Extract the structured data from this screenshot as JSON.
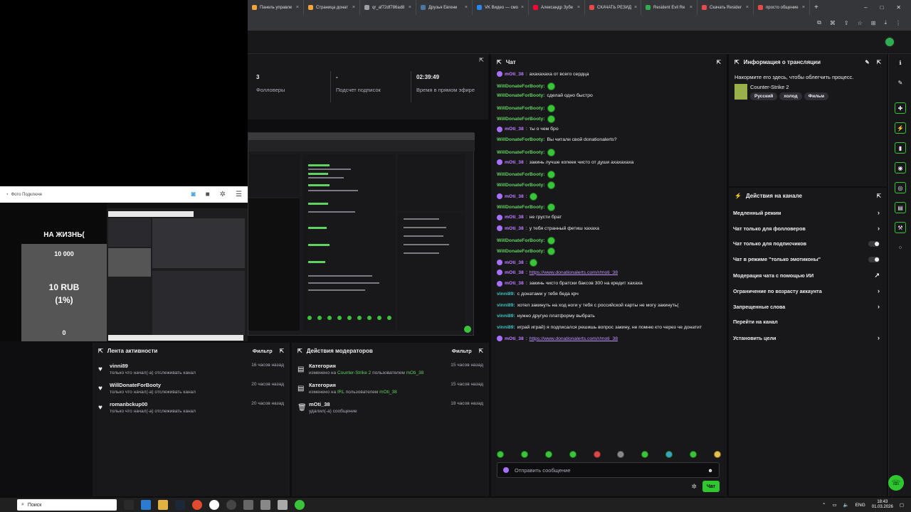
{
  "browser": {
    "tabs": [
      {
        "label": "Панель управле",
        "color": "#f2a33a"
      },
      {
        "label": "Страница донат",
        "color": "#f2a33a"
      },
      {
        "label": "qr_af72df786ad8",
        "color": "#9aa0a6"
      },
      {
        "label": "Друзья Евгени",
        "color": "#4a76a8"
      },
      {
        "label": "VK Видео — смо",
        "color": "#2787f5"
      },
      {
        "label": "Александр Зубе",
        "color": "#ff0033"
      },
      {
        "label": "СКАЧАТЬ РЕЗИД",
        "color": "#e84a4a"
      },
      {
        "label": "Resident Evil Re",
        "color": "#2fae4f"
      },
      {
        "label": "Скачать Resider",
        "color": "#e84a4a"
      },
      {
        "label": "просто общение",
        "color": "#e84a4a"
      }
    ],
    "new_tab": "+",
    "window_controls": [
      "–",
      "□",
      "✕"
    ]
  },
  "stats": {
    "followers_value": "3",
    "followers_label": "Фолловеры",
    "subs_value": "-",
    "subs_label": "Подсчет подписок",
    "live_value": "02:39:49",
    "live_label": "Время в прямом эфире"
  },
  "obs": {
    "source_label": "Фото Подключе"
  },
  "alert": {
    "headline": "НА ЖИЗНЬ(",
    "goal": "10 000",
    "amount": "10 RUB",
    "percent": "(1%)",
    "current": "0"
  },
  "activity": {
    "title": "Лента активности",
    "filter": "Фильтр",
    "items": [
      {
        "name": "vinni89",
        "desc": "только что начал(-а) отслеживать канал",
        "time": "16 часов назад"
      },
      {
        "name": "WillDonateForBooty",
        "desc": "только что начал(-а) отслеживать канал",
        "time": "20 часов назад"
      },
      {
        "name": "romanbckup00",
        "desc": "только что начал(-а) отслеживать канал",
        "time": "20 часов назад"
      }
    ]
  },
  "mod": {
    "title": "Действия модераторов",
    "filter": "Фильтр",
    "items": [
      {
        "title": "Категория",
        "pre": "изменено на",
        "hl": "Counter-Strike 2",
        "mid": "пользователем",
        "user": "mOti_38",
        "time": "15 часов назад"
      },
      {
        "title": "Категория",
        "pre": "изменено на",
        "hl": "IRL",
        "mid": "пользователем",
        "user": "mOti_38",
        "time": "15 часов назад"
      },
      {
        "title": "mOti_38",
        "pre": "удалил(-а) сообщение",
        "hl": "",
        "mid": "",
        "user": "",
        "time": "18 часов назад"
      }
    ]
  },
  "chat": {
    "title": "Чат",
    "input_placeholder": "Отправить сообщение",
    "send_label": "Чат",
    "messages": [
      {
        "user": "mOti_38",
        "type": "m",
        "text": "ахахахаха от всего сердца"
      },
      {
        "user": "WillDonateForBooty:",
        "type": "w",
        "text": "",
        "emote": true
      },
      {
        "user": "WillDonateForBooty:",
        "type": "w",
        "text": "сделай одно быстро"
      },
      {
        "user": "WillDonateForBooty:",
        "type": "w",
        "text": "",
        "emote": true
      },
      {
        "user": "WillDonateForBooty:",
        "type": "w",
        "text": "",
        "emote": true
      },
      {
        "user": "mOti_38",
        "type": "m",
        "text": "ты о чем бро"
      },
      {
        "user": "WillDonateForBooty:",
        "type": "w",
        "text": "Вы читали свой donationalerts?"
      },
      {
        "user": "WillDonateForBooty:",
        "type": "w",
        "text": "",
        "emote": true
      },
      {
        "user": "mOti_38",
        "type": "m",
        "text": "закинь лучше копеек чисто от души ахахахаха"
      },
      {
        "user": "WillDonateForBooty:",
        "type": "w",
        "text": "",
        "emote": true
      },
      {
        "user": "WillDonateForBooty:",
        "type": "w",
        "text": "",
        "emote": true
      },
      {
        "user": "mOti_38",
        "type": "m",
        "text": "",
        "emote": true
      },
      {
        "user": "WillDonateForBooty:",
        "type": "w",
        "text": "",
        "emote": true
      },
      {
        "user": "mOti_38",
        "type": "m",
        "text": "не грусти брат"
      },
      {
        "user": "mOti_38",
        "type": "m",
        "text": "у тебя странный фетиш хахаха"
      },
      {
        "user": "WillDonateForBooty:",
        "type": "w",
        "text": "",
        "emote": true
      },
      {
        "user": "WillDonateForBooty:",
        "type": "w",
        "text": "",
        "emote": true
      },
      {
        "user": "mOti_38",
        "type": "m",
        "text": "",
        "emote": true
      },
      {
        "user": "mOti_38",
        "type": "m",
        "text": "https://www.donationalerts.com/r/moti_38",
        "link": true
      },
      {
        "user": "mOti_38",
        "type": "m",
        "text": "закинь чисто братски баксов 300 на кредит хахаха"
      },
      {
        "user": "vinni89:",
        "type": "v",
        "text": "с донатами у тебя беда крч"
      },
      {
        "user": "vinni89:",
        "type": "v",
        "text": "хотел закинуть на ход ноги у тебя с российской карты не могу закинуть("
      },
      {
        "user": "vinni89:",
        "type": "v",
        "text": "нужно другую платформу выбрать"
      },
      {
        "user": "vinni89:",
        "type": "v",
        "text": "играй играй) я подписался решишь вопрос закину, не помню кто через че донатит"
      },
      {
        "user": "mOti_38",
        "type": "m",
        "text": "https://www.donationalerts.com/r/moti_38",
        "link": true
      }
    ]
  },
  "info": {
    "title": "Информация о трансляции",
    "prompt": "Накормите его здесь, чтобы облегчить процесс.",
    "game": "Counter-Strike 2",
    "tags": [
      "Русский",
      "холод",
      "Фильм"
    ]
  },
  "channel_actions": {
    "title": "Действия на канале",
    "items": [
      {
        "label": "Медленный режим",
        "kind": "chev"
      },
      {
        "label": "Чат только для фолловеров",
        "kind": "chev"
      },
      {
        "label": "Чат только для подписчиков",
        "kind": "toggle"
      },
      {
        "label": "Чат в режиме \"только эмотиконы\"",
        "kind": "toggle"
      },
      {
        "label": "Модерация чата с помощью ИИ",
        "kind": "ext"
      },
      {
        "label": "Ограничение по возрасту аккаунта",
        "kind": "chev"
      },
      {
        "label": "Запрещенные слова",
        "kind": "chev"
      },
      {
        "label": "Перейти на канал",
        "kind": "none"
      },
      {
        "label": "Установить цели",
        "kind": "chev"
      }
    ]
  },
  "taskbar": {
    "search": "Поиск",
    "lang": "ENG",
    "time": "18:43",
    "date": "01.03.2026"
  }
}
